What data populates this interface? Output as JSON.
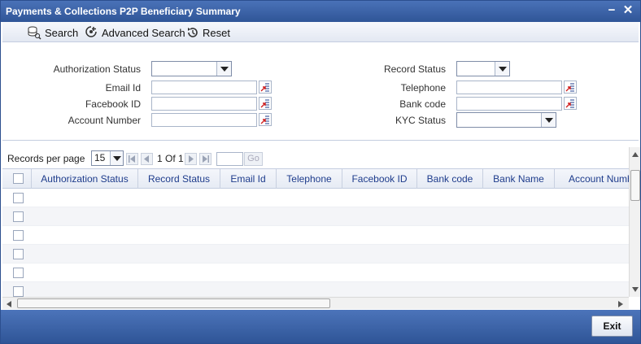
{
  "window": {
    "title": "Payments & Collections P2P Beneficiary Summary"
  },
  "toolbar": {
    "search_label": "Search",
    "advanced_search_label": "Advanced Search",
    "reset_label": "Reset"
  },
  "form": {
    "authorization_status_label": "Authorization Status",
    "email_id_label": "Email Id",
    "facebook_id_label": "Facebook ID",
    "account_number_label": "Account Number",
    "record_status_label": "Record Status",
    "telephone_label": "Telephone",
    "bank_code_label": "Bank code",
    "kyc_status_label": "KYC Status"
  },
  "pager": {
    "records_per_page_label": "Records per page",
    "records_per_page_value": "15",
    "page_info": "1 Of 1",
    "go_label": "Go"
  },
  "grid": {
    "columns": [
      "Authorization Status",
      "Record Status",
      "Email Id",
      "Telephone",
      "Facebook ID",
      "Bank code",
      "Bank Name",
      "Account Number"
    ]
  },
  "footer": {
    "exit_label": "Exit"
  },
  "colors": {
    "titlebar": "#2f5597",
    "header_text": "#1e3c8c"
  }
}
